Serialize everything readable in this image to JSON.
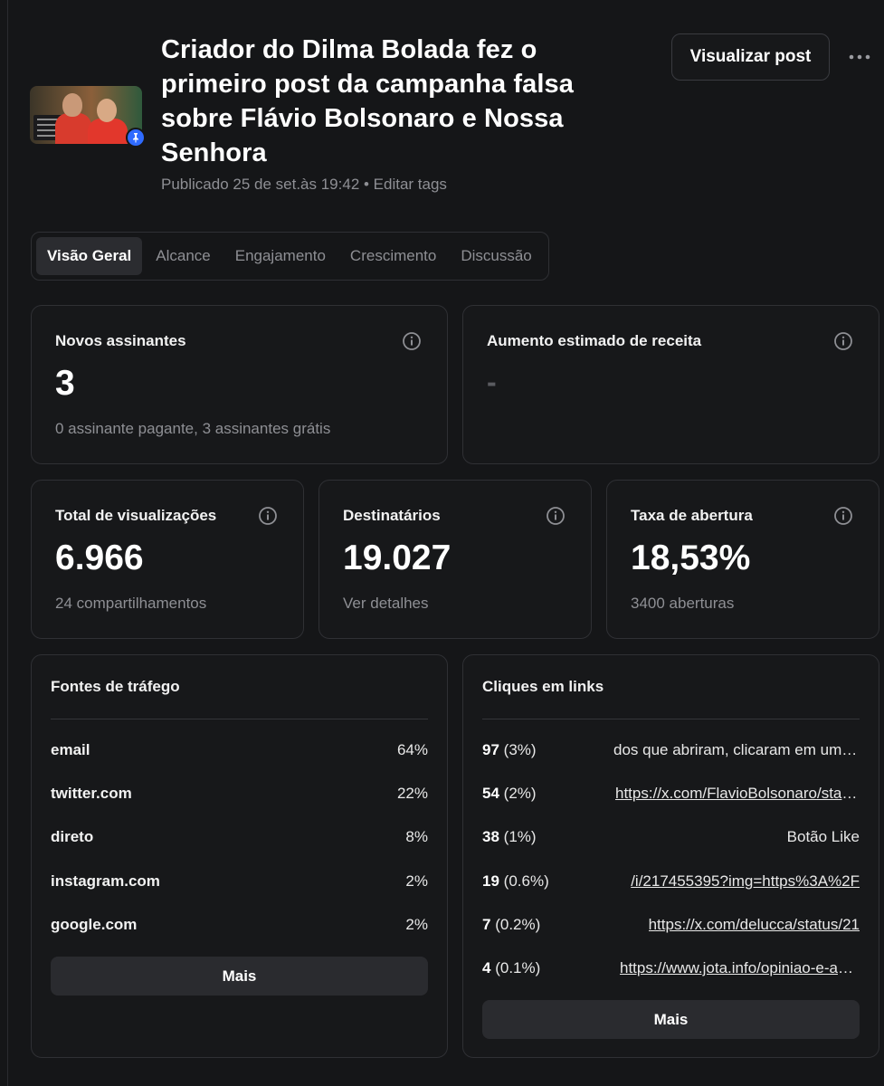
{
  "post": {
    "title": "Criador do Dilma Bolada fez o primeiro post da campanha falsa sobre Flávio Bolsonaro e Nossa Senhora",
    "meta": "Publicado 25 de set.às 19:42 • Editar tags",
    "view_button": "Visualizar post"
  },
  "tabs": [
    {
      "label": "Visão Geral",
      "active": true
    },
    {
      "label": "Alcance"
    },
    {
      "label": "Engajamento"
    },
    {
      "label": "Crescimento"
    },
    {
      "label": "Discussão"
    }
  ],
  "stats": {
    "novos_assinantes": {
      "label": "Novos assinantes",
      "value": "3",
      "sub": "0 assinante pagante, 3 assinantes grátis"
    },
    "aumento_receita": {
      "label": "Aumento estimado de receita",
      "value": "-"
    },
    "visualizacoes": {
      "label": "Total de visualizações",
      "value": "6.966",
      "sub": "24 compartilhamentos"
    },
    "destinatarios": {
      "label": "Destinatários",
      "value": "19.027",
      "sub": "Ver detalhes"
    },
    "taxa_abertura": {
      "label": "Taxa de abertura",
      "value": "18,53%",
      "sub": "3400 aberturas"
    }
  },
  "traffic": {
    "title": "Fontes de tráfego",
    "rows": [
      {
        "name": "email",
        "pct": "64%"
      },
      {
        "name": "twitter.com",
        "pct": "22%"
      },
      {
        "name": "direto",
        "pct": "8%"
      },
      {
        "name": "instagram.com",
        "pct": "2%"
      },
      {
        "name": "google.com",
        "pct": "2%"
      }
    ],
    "more": "Mais"
  },
  "clicks": {
    "title": "Cliques em links",
    "rows": [
      {
        "count": "97",
        "pct": "(3%)",
        "target": "dos que abriram, clicaram em um link",
        "link": false
      },
      {
        "count": "54",
        "pct": "(2%)",
        "target": "https://x.com/FlavioBolsonaro/status",
        "link": true
      },
      {
        "count": "38",
        "pct": "(1%)",
        "target": "Botão Like",
        "link": false
      },
      {
        "count": "19",
        "pct": "(0.6%)",
        "target": "/i/217455395?img=https%3A%2F",
        "link": true
      },
      {
        "count": "7",
        "pct": "(0.2%)",
        "target": "https://x.com/delucca/status/21",
        "link": true
      },
      {
        "count": "4",
        "pct": "(0.1%)",
        "target": "https://www.jota.info/opiniao-e-analise",
        "link": true
      }
    ],
    "more": "Mais"
  }
}
